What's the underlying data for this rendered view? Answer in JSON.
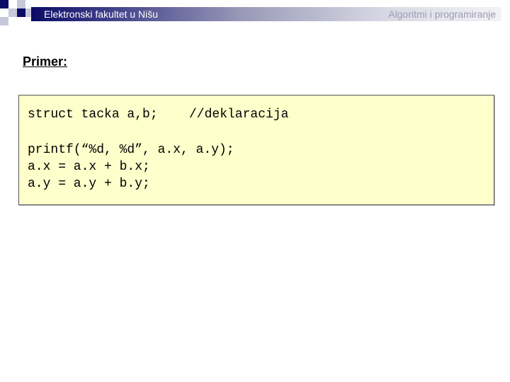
{
  "header": {
    "course_left": "Elektronski fakultet u Nišu",
    "course_right": "Algoritmi i programiranje",
    "bar_color_dark": "#0b0b66",
    "bar_color_light": "#f2f2f6"
  },
  "slide": {
    "heading": "Primer:"
  },
  "code_box": {
    "background": "#ffffcc",
    "lines": [
      "struct tacka a,b;",
      "printf(“%d, %d”, a.x, a.y);",
      "a.x = a.x + b.x;",
      "a.y = a.y + b.y;"
    ],
    "comment": "//deklaracija"
  }
}
